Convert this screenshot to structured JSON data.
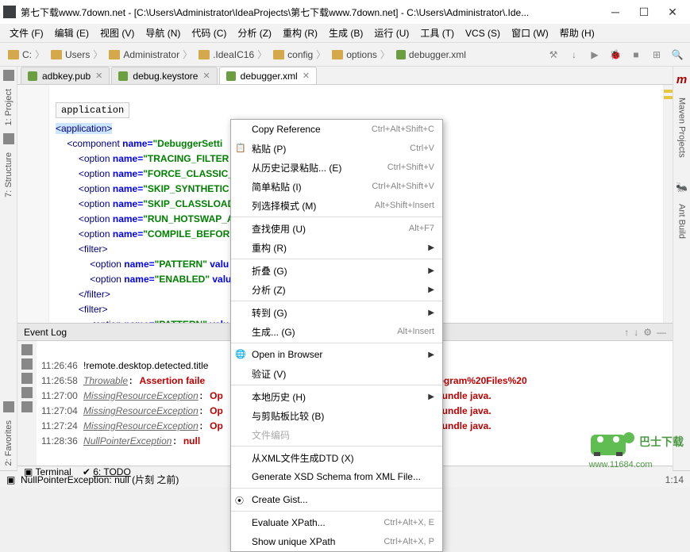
{
  "window": {
    "title": "第七下载www.7down.net - [C:\\Users\\Administrator\\IdeaProjects\\第七下载www.7down.net] - C:\\Users\\Administrator\\.Ide..."
  },
  "menus": [
    "文件 (F)",
    "编辑 (E)",
    "视图 (V)",
    "导航 (N)",
    "代码 (C)",
    "分析 (Z)",
    "重构 (R)",
    "生成 (B)",
    "运行 (U)",
    "工具 (T)",
    "VCS (S)",
    "窗口 (W)",
    "帮助 (H)"
  ],
  "breadcrumbs": [
    "C:",
    "Users",
    "Administrator",
    ".IdeaIC16",
    "config",
    "options",
    "debugger.xml"
  ],
  "tabs": [
    {
      "label": "adbkey.pub",
      "active": false
    },
    {
      "label": "debug.keystore",
      "active": false
    },
    {
      "label": "debugger.xml",
      "active": true
    }
  ],
  "editor_breadcrumb": "application",
  "code": {
    "l1": "<application>",
    "l2_pre": "<component ",
    "l2_attr": "name=",
    "l2_str": "\"DebuggerSetti",
    "l3_pre": "<option ",
    "l3_attr": "name=",
    "l3_str": "\"TRACING_FILTER",
    "l4_pre": "<option ",
    "l4_attr": "name=",
    "l4_str": "\"FORCE_CLASSIC_",
    "l5_pre": "<option ",
    "l5_attr": "name=",
    "l5_str": "\"SKIP_SYNTHETIC",
    "l6_pre": "<option ",
    "l6_attr": "name=",
    "l6_str": "\"SKIP_CLASSLOAD",
    "l7_pre": "<option ",
    "l7_attr": "name=",
    "l7_str": "\"RUN_HOTSWAP_AF",
    "l8_pre": "<option ",
    "l8_attr": "name=",
    "l8_str": "\"COMPILE_BEFORE",
    "l9": "<filter>",
    "l10_pre": "<option ",
    "l10_attr": "name=",
    "l10_str": "\"PATTERN\"",
    "l10_post": " valu",
    "l11_pre": "<option ",
    "l11_attr": "name=",
    "l11_str": "\"ENABLED\"",
    "l11_post": " valu",
    "l12": "</filter>",
    "l13": "<filter>",
    "l14_pre": "<option ",
    "l14_attr": "name=",
    "l14_str": "\"PATTERN\"",
    "l14_post": " valu"
  },
  "event_log": {
    "title": "Event Log",
    "r1_ts": "11:26:46",
    "r1_txt": "!remote.desktop.detected.title",
    "r2_ts": "11:26:58",
    "r2_thr": "Throwable",
    "r2_msg": "Assertion faile",
    "r2_tail": "n.java [jar:file:/C:/Program%20Files%20",
    "r3_ts": "11:27:00",
    "r3_thr": "MissingResourceException",
    "r3_msg": "Op",
    "r3_tail": ": Can't find resource for bundle java.",
    "r4_ts": "11:27:04",
    "r4_thr": "MissingResourceException",
    "r4_msg": "Op",
    "r4_tail": ": Can't find resource for bundle java.",
    "r5_ts": "11:27:24",
    "r5_thr": "MissingResourceException",
    "r5_msg": "Op",
    "r5_tail": ": Can't find resource for bundle java.",
    "r6_ts": "11:28:36",
    "r6_thr": "NullPointerException",
    "r6_msg": "null"
  },
  "bottom": {
    "terminal": "Terminal",
    "todo": "6: TODO"
  },
  "status": {
    "msg": "NullPointerException: null (片刻 之前)",
    "pos": "1:14"
  },
  "left_tabs": {
    "project": "1: Project",
    "structure": "7: Structure",
    "favorites": "2: Favorites"
  },
  "right_tabs": {
    "maven": "Maven Projects",
    "ant": "Ant Build"
  },
  "ctx": [
    {
      "lbl": "Copy Reference",
      "sc": "Ctrl+Alt+Shift+C"
    },
    {
      "lbl": "粘贴 (P)",
      "sc": "Ctrl+V",
      "icon": "paste"
    },
    {
      "lbl": "从历史记录粘贴... (E)",
      "sc": "Ctrl+Shift+V"
    },
    {
      "lbl": "简单粘贴 (I)",
      "sc": "Ctrl+Alt+Shift+V"
    },
    {
      "lbl": "列选择模式 (M)",
      "sc": "Alt+Shift+Insert"
    },
    {
      "sep": true
    },
    {
      "lbl": "查找使用 (U)",
      "sc": "Alt+F7"
    },
    {
      "lbl": "重构 (R)",
      "arr": true
    },
    {
      "sep": true
    },
    {
      "lbl": "折叠 (G)",
      "arr": true
    },
    {
      "lbl": "分析 (Z)",
      "arr": true
    },
    {
      "sep": true
    },
    {
      "lbl": "转到 (G)",
      "arr": true
    },
    {
      "lbl": "生成... (G)",
      "sc": "Alt+Insert"
    },
    {
      "sep": true
    },
    {
      "lbl": "Open in Browser",
      "arr": true,
      "icon": "globe"
    },
    {
      "lbl": "验证 (V)"
    },
    {
      "sep": true
    },
    {
      "lbl": "本地历史 (H)",
      "arr": true
    },
    {
      "lbl": "与剪贴板比较 (B)"
    },
    {
      "lbl": "文件编码",
      "dis": true
    },
    {
      "sep": true
    },
    {
      "lbl": "从XML文件生成DTD (X)"
    },
    {
      "lbl": "Generate XSD Schema from XML File..."
    },
    {
      "sep": true
    },
    {
      "lbl": "Create Gist...",
      "icon": "gist"
    },
    {
      "sep": true
    },
    {
      "lbl": "Evaluate XPath...",
      "sc": "Ctrl+Alt+X, E"
    },
    {
      "lbl": "Show unique XPath",
      "sc": "Ctrl+Alt+X, P"
    }
  ],
  "watermark": {
    "text": "巴士下载",
    "url": "www.11684.com"
  }
}
